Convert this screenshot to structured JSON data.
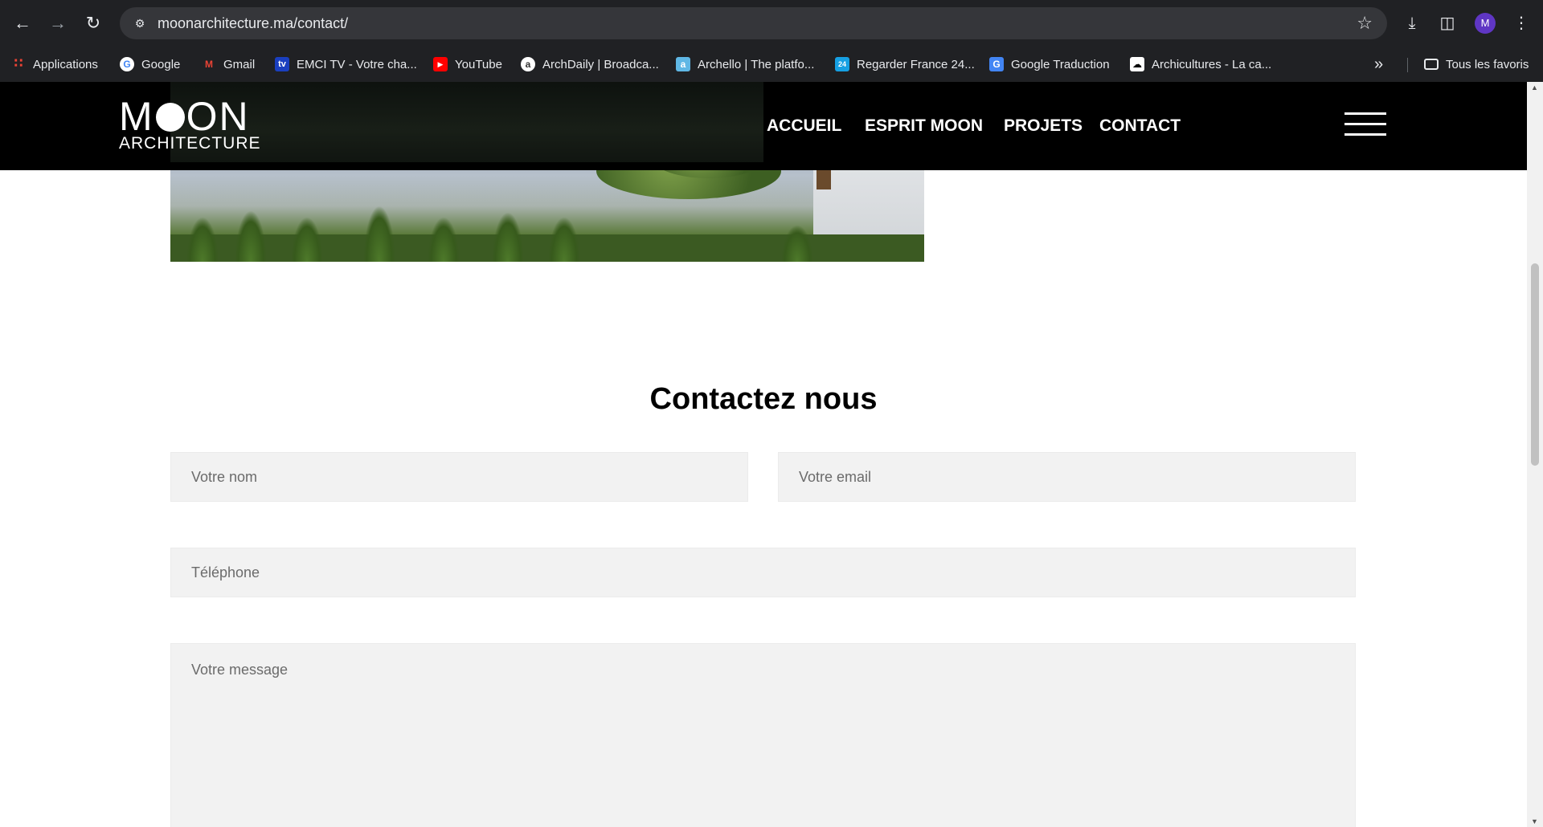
{
  "browser": {
    "url": "moonarchitecture.ma/contact/",
    "profile_initial": "M",
    "bookmarks": [
      {
        "label": "Applications",
        "icon": "apps-grid-icon",
        "color": "#ea4335"
      },
      {
        "label": "Google",
        "icon": "google-icon",
        "color": "#4285f4"
      },
      {
        "label": "Gmail",
        "icon": "gmail-icon",
        "color": "#ea4335"
      },
      {
        "label": "EMCI TV - Votre cha...",
        "icon": "emci-tv-icon",
        "color": "#1a3fbf"
      },
      {
        "label": "YouTube",
        "icon": "youtube-icon",
        "color": "#ff0000"
      },
      {
        "label": "ArchDaily | Broadca...",
        "icon": "archdaily-icon",
        "color": "#9aa0a6"
      },
      {
        "label": "Archello | The platfo...",
        "icon": "archello-icon",
        "color": "#5fb7e5"
      },
      {
        "label": "Regarder France 24...",
        "icon": "france24-icon",
        "color": "#16a0e3"
      },
      {
        "label": "Google Traduction",
        "icon": "google-translate-icon",
        "color": "#4285f4"
      },
      {
        "label": "Archicultures - La ca...",
        "icon": "archicultures-icon",
        "color": "#000000"
      }
    ],
    "all_bookmarks_label": "Tous les favoris"
  },
  "site": {
    "logo_top_left": "M",
    "logo_top_right": "ON",
    "logo_bottom": "ARCHITECTURE",
    "nav": [
      "ACCUEIL",
      "ESPRIT MOON",
      "PROJETS",
      "CONTACT"
    ]
  },
  "contact": {
    "title": "Contactez nous",
    "name_placeholder": "Votre nom",
    "email_placeholder": "Votre email",
    "phone_placeholder": "Téléphone",
    "message_placeholder": "Votre message"
  },
  "colors": {
    "chrome_bg": "#202124",
    "header_bg": "#000000",
    "field_bg": "#f2f2f2"
  }
}
